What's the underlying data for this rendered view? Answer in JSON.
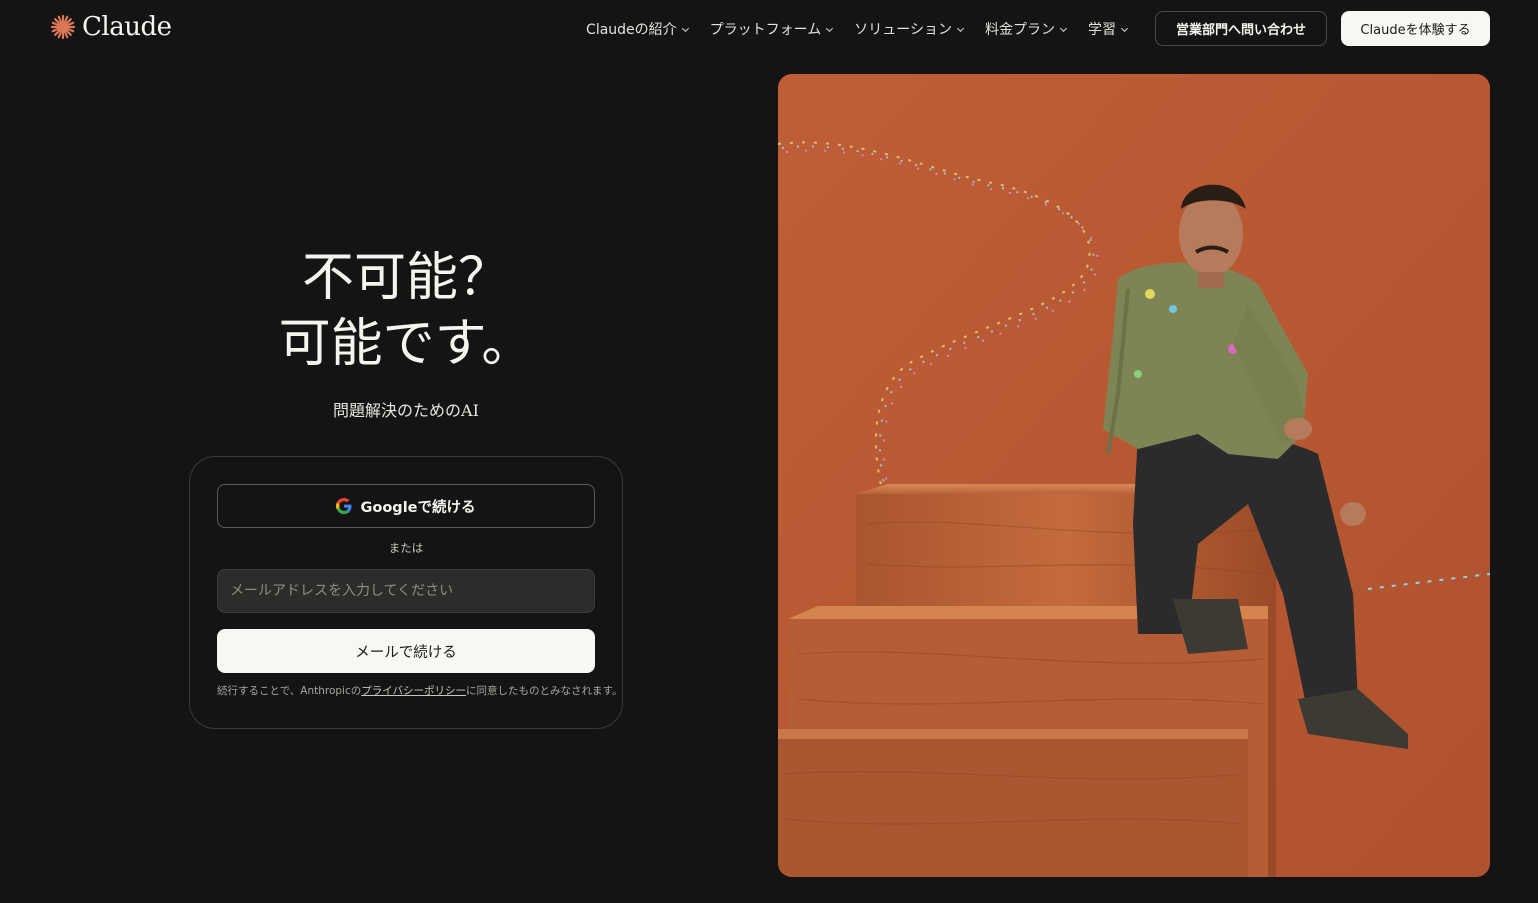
{
  "header": {
    "brand": "Claude",
    "nav": [
      {
        "label": "Claudeの紹介"
      },
      {
        "label": "プラットフォーム"
      },
      {
        "label": "ソリューション"
      },
      {
        "label": "料金プラン"
      },
      {
        "label": "学習"
      }
    ],
    "contact_sales": "営業部門へ問い合わせ",
    "try_claude": "Claudeを体験する"
  },
  "hero": {
    "headline_line1": "不可能？",
    "headline_line2": "可能です。",
    "subheadline": "問題解決のためのAI"
  },
  "signin": {
    "google_button": "Googleで続ける",
    "or_divider": "または",
    "email_placeholder": "メールアドレスを入力してください",
    "email_value": "",
    "email_button": "メールで続ける",
    "legal_prefix": "続行することで、Anthropicの",
    "privacy_link": "プライバシーポリシー",
    "legal_suffix": "に同意したものとみなされます。"
  },
  "colors": {
    "background": "#141414",
    "brand_accent": "#d97757",
    "photo_background": "#b95a34"
  },
  "icons": {
    "logo": "claude-starburst-icon",
    "nav_dropdown": "chevron-down-icon",
    "google": "google-g-icon"
  }
}
